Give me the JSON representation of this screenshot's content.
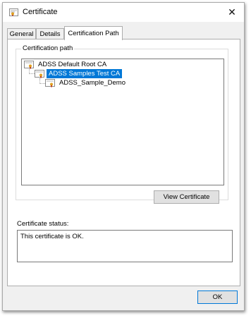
{
  "window": {
    "title": "Certificate",
    "close_glyph": "✕",
    "app_icon": "certificate-icon"
  },
  "tabs": [
    {
      "label": "General",
      "active": false
    },
    {
      "label": "Details",
      "active": false
    },
    {
      "label": "Certification Path",
      "active": true
    }
  ],
  "certification_path": {
    "group_label": "Certification path",
    "nodes": [
      {
        "label": "ADSS Default Root CA",
        "selected": false
      },
      {
        "label": "ADSS Samples Test CA",
        "selected": true
      },
      {
        "label": "ADSS_Sample_Demo",
        "selected": false
      }
    ],
    "view_button_label": "View Certificate"
  },
  "status": {
    "label": "Certificate status:",
    "text": "This certificate is OK."
  },
  "footer": {
    "ok_label": "OK"
  },
  "colors": {
    "selection": "#0078d7",
    "dialog_bg": "#f0f0f0",
    "ok_border": "#0078d7"
  }
}
